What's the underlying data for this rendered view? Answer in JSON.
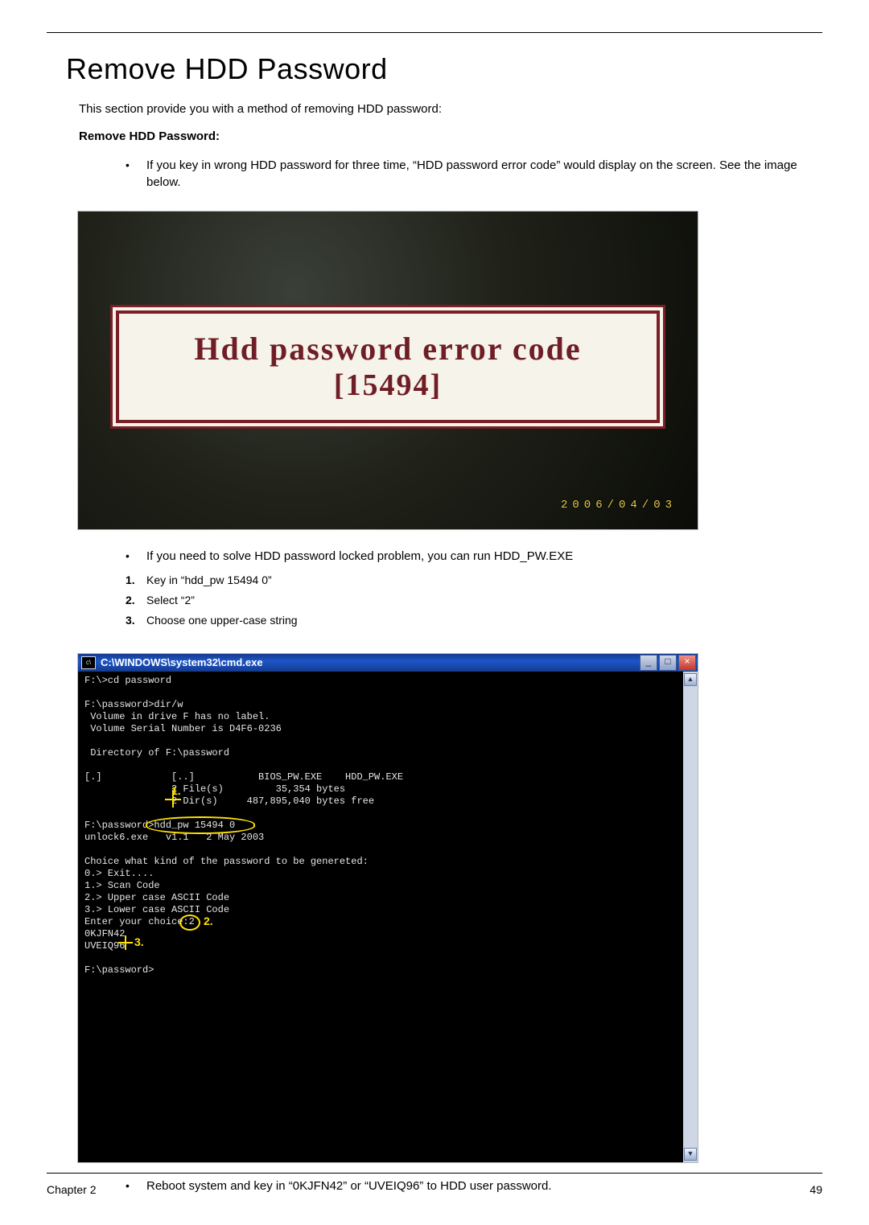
{
  "page": {
    "title": "Remove HDD Password",
    "intro": "This section provide you with a method of removing HDD password:",
    "subhead": "Remove HDD Password:",
    "bullet_before_img": "If you key in wrong HDD password for three time, “HDD password error code” would display on the screen. See the image below.",
    "bullet_after_img": "If you need to solve HDD password locked problem, you can run HDD_PW.EXE",
    "steps": [
      "Key in “hdd_pw 15494 0”",
      "Select “2”",
      "Choose one upper-case string"
    ],
    "bullet_after_cmd": "Reboot system and key in “0KJFN42” or “UVEIQ96” to HDD user password.",
    "chapter_label": "Chapter 2",
    "page_number": "49"
  },
  "photo1": {
    "panel_line": "Hdd password error code",
    "panel_code": "[15494]",
    "datestamp": "2006/04/03"
  },
  "cmd": {
    "title": "C:\\WINDOWS\\system32\\cmd.exe",
    "icon_text": "c\\",
    "btn_min": "_",
    "btn_max": "□",
    "btn_close": "×",
    "scroll_up": "▲",
    "scroll_down": "▼",
    "lines": [
      "F:\\>cd password",
      "",
      "F:\\password>dir/w",
      " Volume in drive F has no label.",
      " Volume Serial Number is D4F6-0236",
      "",
      " Directory of F:\\password",
      "",
      "[.]            [..]           BIOS_PW.EXE    HDD_PW.EXE",
      "               2 File(s)         35,354 bytes",
      "               2 Dir(s)     487,895,040 bytes free",
      "",
      "F:\\password>hdd_pw 15494 0",
      "unlock6.exe   v1.1   2 May 2003",
      "",
      "Choice what kind of the password to be genereted:",
      "0.> Exit....",
      "1.> Scan Code",
      "2.> Upper case ASCII Code",
      "3.> Lower case ASCII Code",
      "Enter your choice:2",
      "0KJFN42",
      "UVEIQ96",
      "",
      "F:\\password>"
    ],
    "anno": {
      "label1": "1.",
      "label2": "2.",
      "label3": "3."
    }
  }
}
